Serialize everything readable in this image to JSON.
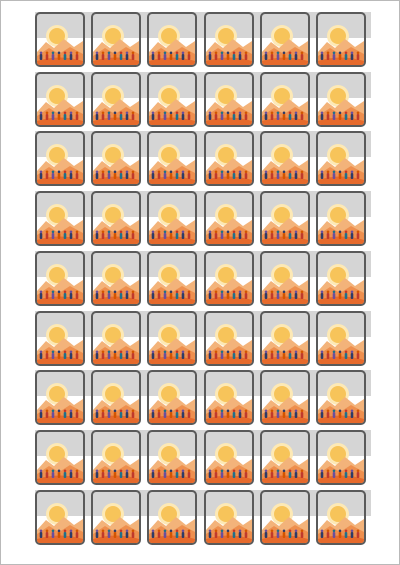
{
  "sheet": {
    "grid": {
      "rows": 9,
      "columns": 6
    },
    "colors": {
      "band": "#d5d5d5",
      "tile_border": "#5a5a5a",
      "sun": "#f7c45a",
      "sun_glow": "#fde9b5",
      "dune_far": "#f3b37a",
      "dune_mid": "#ee8f4e",
      "dune_near": "#e66a2c",
      "figures": [
        "#2e3a66",
        "#c0392b",
        "#6b4e9b",
        "#d35400",
        "#1f6f8b"
      ]
    }
  }
}
